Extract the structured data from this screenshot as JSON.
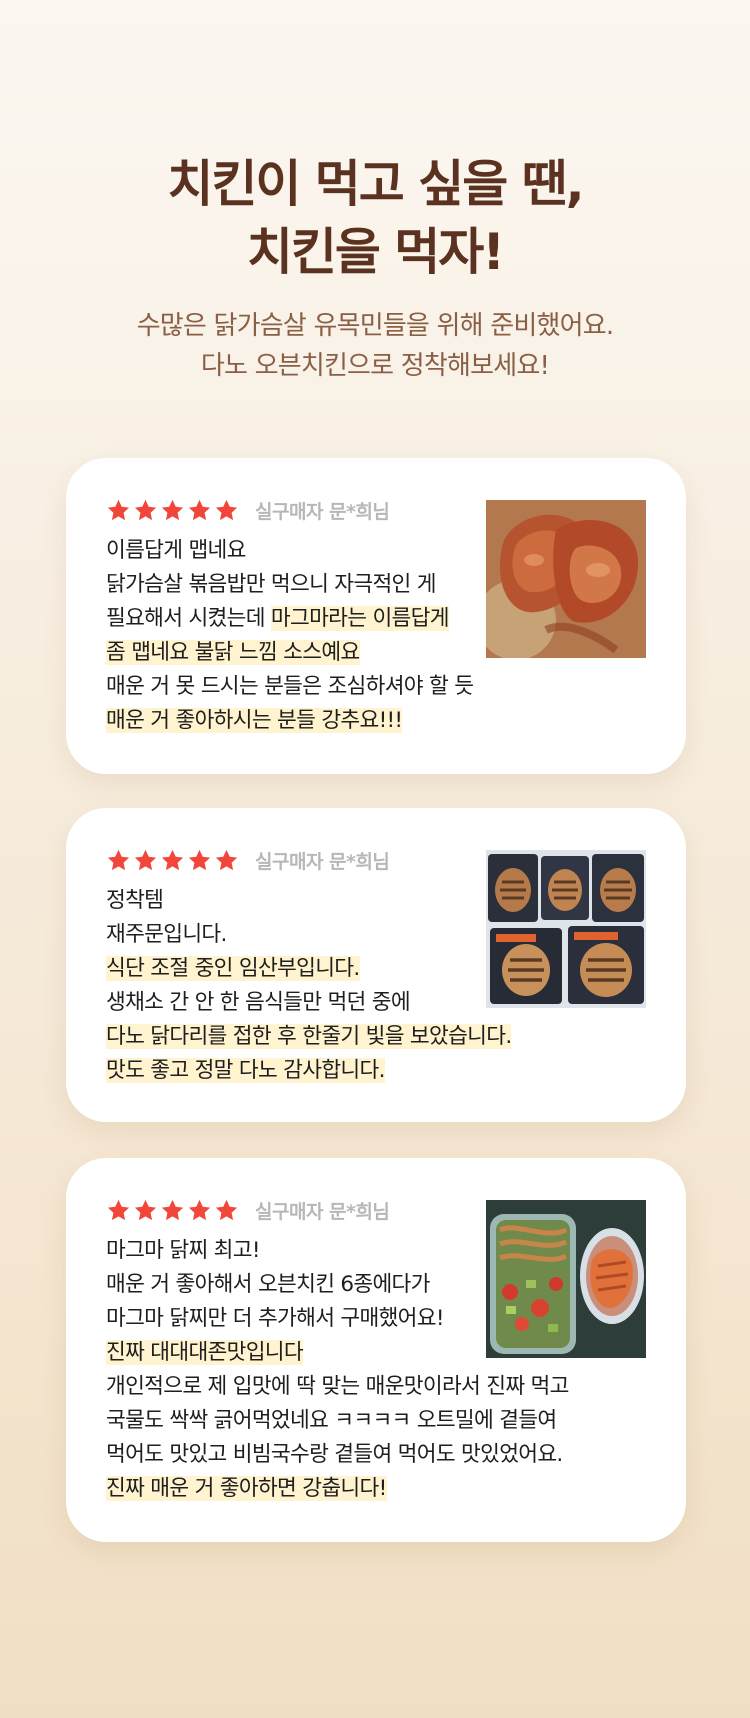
{
  "hero": {
    "title_line1": "치킨이 먹고 싶을 땐,",
    "title_line2": "치킨을 먹자!",
    "subtitle_line1": "수많은 닭가슴살 유목민들을 위해 준비했어요.",
    "subtitle_line2": "다노 오븐치킨으로 정착해보세요!"
  },
  "colors": {
    "title": "#5b3220",
    "subtitle": "#8a5f45",
    "star": "#f2463a",
    "highlight": "#fff4cf"
  },
  "reviews": [
    {
      "rating": 5,
      "reviewer": "실구매자 문*희님",
      "photo_icon": "spicy-chicken-photo",
      "lines": [
        {
          "parts": [
            {
              "text": "이름답게 맵네요",
              "hl": false
            }
          ]
        },
        {
          "parts": [
            {
              "text": "닭가슴살 볶음밥만 먹으니 자극적인 게",
              "hl": false
            }
          ]
        },
        {
          "parts": [
            {
              "text": "필요해서 시켰는데 ",
              "hl": false
            },
            {
              "text": "마그마라는 이름답게",
              "hl": true
            }
          ]
        },
        {
          "parts": [
            {
              "text": "좀 맵네요 불닭 느낌 소스예요",
              "hl": true
            }
          ]
        },
        {
          "parts": [
            {
              "text": "매운 거 못 드시는 분들은 조심하셔야 할 듯",
              "hl": false
            }
          ]
        },
        {
          "parts": [
            {
              "text": "매운 거 좋아하시는 분들 강추요!!!",
              "hl": true
            }
          ]
        }
      ]
    },
    {
      "rating": 5,
      "reviewer": "실구매자 문*희님",
      "photo_icon": "packaged-chicken-photo",
      "lines": [
        {
          "parts": [
            {
              "text": "정착템",
              "hl": false
            }
          ]
        },
        {
          "parts": [
            {
              "text": "재주문입니다.",
              "hl": false
            }
          ]
        },
        {
          "parts": [
            {
              "text": "식단 조절 중인 임산부입니다.",
              "hl": true
            }
          ]
        },
        {
          "parts": [
            {
              "text": "생채소 간 안 한 음식들만 먹던 중에",
              "hl": false
            }
          ]
        },
        {
          "parts": [
            {
              "text": "다노 닭다리를 접한 후 한줄기 빛을 보았습니다.",
              "hl": true
            }
          ]
        },
        {
          "parts": [
            {
              "text": "맛도 좋고 정말 다노 감사합니다.",
              "hl": true
            }
          ]
        }
      ]
    },
    {
      "rating": 5,
      "reviewer": "실구매자 문*희님",
      "photo_icon": "lunchbox-photo",
      "lines": [
        {
          "parts": [
            {
              "text": "마그마 닭찌 최고!",
              "hl": false
            }
          ]
        },
        {
          "parts": [
            {
              "text": "매운 거 좋아해서 오븐치킨 6종에다가",
              "hl": false
            }
          ]
        },
        {
          "parts": [
            {
              "text": "마그마 닭찌만 더 추가해서 구매했어요!",
              "hl": false
            }
          ]
        },
        {
          "parts": [
            {
              "text": "진짜 대대대존맛입니다",
              "hl": true
            }
          ]
        },
        {
          "parts": [
            {
              "text": "개인적으로 제 입맛에 딱 맞는 매운맛이라서 진짜 먹고",
              "hl": false
            }
          ]
        },
        {
          "parts": [
            {
              "text": "국물도 싹싹 긁어먹었네요 ㅋㅋㅋㅋ 오트밀에 곁들여",
              "hl": false
            }
          ]
        },
        {
          "parts": [
            {
              "text": "먹어도 맛있고 비빔국수랑 곁들여 먹어도 맛있었어요.",
              "hl": false
            }
          ]
        },
        {
          "parts": [
            {
              "text": "진짜 매운 거 좋아하면 강춥니다!",
              "hl": true
            }
          ]
        }
      ]
    }
  ]
}
